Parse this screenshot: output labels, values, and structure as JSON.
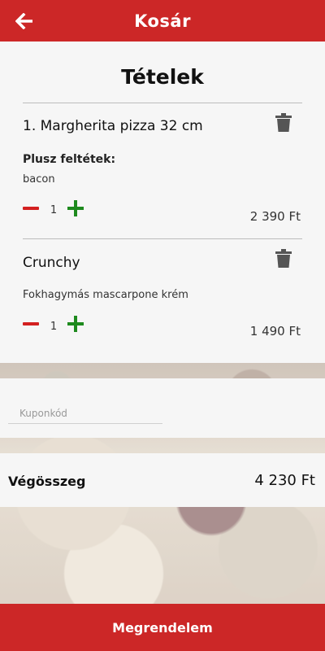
{
  "header": {
    "title": "Kosár",
    "back_icon": "arrow-left-icon"
  },
  "items_section": {
    "title": "Tételek"
  },
  "items": [
    {
      "name": "1. Margherita pizza 32 cm",
      "extras_label": "Plusz feltétek:",
      "extras": "bacon",
      "quantity": "1",
      "price": "2 390 Ft"
    },
    {
      "name": "Crunchy",
      "extras": "Fokhagymás mascarpone krém",
      "quantity": "1",
      "price": "1 490 Ft"
    }
  ],
  "coupon": {
    "placeholder": "Kuponkód",
    "value": ""
  },
  "total": {
    "label": "Végösszeg",
    "value": "4 230 Ft"
  },
  "order_button": {
    "label": "Megrendelem"
  },
  "colors": {
    "primary": "#cc2727",
    "minus": "#d32020",
    "plus": "#1e8a1e",
    "trash": "#555555"
  }
}
